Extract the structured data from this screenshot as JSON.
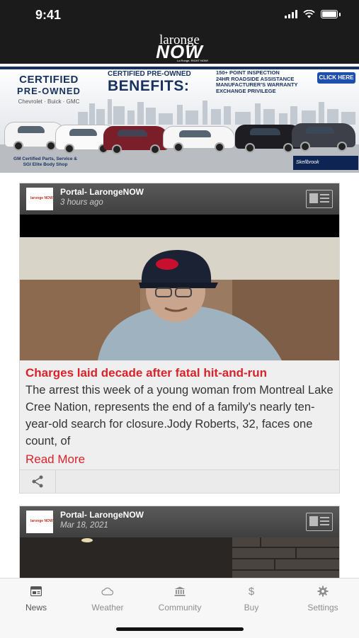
{
  "status_bar": {
    "time": "9:41"
  },
  "header": {
    "logo_top": "laronge",
    "logo_main": "NOW",
    "logo_tagline": "La Ronge. RIGHT NOW!"
  },
  "ad": {
    "certified_line1": "CERTIFIED",
    "certified_line2": "PRE-OWNED",
    "brands": "Chevrolet · Buick · GMC",
    "headline_small": "CERTIFIED PRE-OWNED",
    "headline_big": "BENEFITS:",
    "benefits": [
      "150+ POINT INSPECTION",
      "24HR ROADSIDE ASSISTANCE",
      "MANUFACTURER'S WARRANTY",
      "EXCHANGE PRIVILEGE"
    ],
    "cta": "CLICK HERE",
    "footer_line1": "GM Certified Parts, Service &",
    "footer_line2": "SGI Elite Body Shop",
    "dealer": "Skellbrook"
  },
  "posts": [
    {
      "source": "Portal- LarongeNOW",
      "time": "3 hours ago",
      "title": "Charges laid decade after fatal hit-and-run",
      "excerpt": "The arrest this week of a young woman from Montreal Lake Cree Nation, represents the end of a family's nearly ten-year-old search for closure.Jody Roberts, 32, faces one count, of",
      "read_more": "Read More"
    },
    {
      "source": "Portal- LarongeNOW",
      "time": "Mar 18, 2021"
    }
  ],
  "tabs": [
    {
      "label": "News",
      "icon": "news-icon"
    },
    {
      "label": "Weather",
      "icon": "cloud-icon"
    },
    {
      "label": "Community",
      "icon": "bank-icon"
    },
    {
      "label": "Buy",
      "icon": "dollar-icon"
    },
    {
      "label": "Settings",
      "icon": "gear-icon"
    }
  ],
  "colors": {
    "accent": "#d8232a",
    "header_bg": "#1b1b1b",
    "card_head": "#4a4a4a"
  }
}
